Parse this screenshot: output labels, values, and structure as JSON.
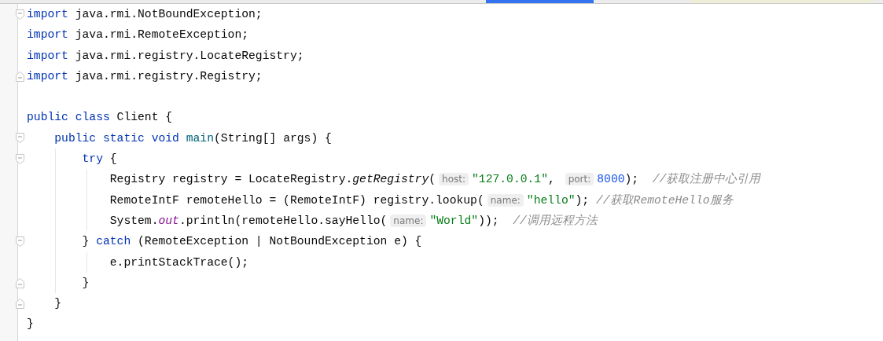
{
  "editor": {
    "lines": [
      {
        "fold": {
          "kind": "start"
        },
        "tokens": [
          {
            "kind": "keyword",
            "text": "import"
          },
          {
            "kind": "plain",
            "text": " java.rmi.NotBoundException;"
          }
        ]
      },
      {
        "tokens": [
          {
            "kind": "keyword",
            "text": "import"
          },
          {
            "kind": "plain",
            "text": " java.rmi.RemoteException;"
          }
        ]
      },
      {
        "tokens": [
          {
            "kind": "keyword",
            "text": "import"
          },
          {
            "kind": "plain",
            "text": " java.rmi.registry.LocateRegistry;"
          }
        ]
      },
      {
        "fold": {
          "kind": "end"
        },
        "tokens": [
          {
            "kind": "keyword",
            "text": "import"
          },
          {
            "kind": "plain",
            "text": " java.rmi.registry.Registry;"
          }
        ]
      },
      {
        "blank_line_before": true,
        "tokens": [
          {
            "kind": "keyword",
            "text": "public class"
          },
          {
            "kind": "plain",
            "text": " Client {"
          }
        ]
      },
      {
        "fold": {
          "kind": "start"
        },
        "tokens": [
          {
            "kind": "keyword",
            "text": "    public static void "
          },
          {
            "kind": "declaration",
            "text": "main"
          },
          {
            "kind": "plain",
            "text": "(String[] args) {"
          }
        ]
      },
      {
        "fold": {
          "kind": "start"
        },
        "tokens": [
          {
            "kind": "keyword",
            "text": "        try"
          },
          {
            "kind": "plain",
            "text": " {"
          }
        ]
      },
      {
        "tokens": [
          {
            "kind": "plain",
            "text": "            Registry registry = LocateRegistry."
          },
          {
            "kind": "static-call",
            "text": "getRegistry"
          },
          {
            "kind": "plain",
            "text": "("
          },
          {
            "kind": "hint",
            "text": "host:"
          },
          {
            "kind": "string",
            "text": "\"127.0.0.1\""
          },
          {
            "kind": "plain",
            "text": ", "
          },
          {
            "kind": "hint",
            "text": "port:"
          },
          {
            "kind": "number",
            "text": "8000"
          },
          {
            "kind": "plain",
            "text": ");  "
          },
          {
            "kind": "comment",
            "text": "//获取注册中心引用"
          }
        ]
      },
      {
        "tokens": [
          {
            "kind": "plain",
            "text": "            RemoteIntF remoteHello = (RemoteIntF) registry.lookup("
          },
          {
            "kind": "hint",
            "text": "name:"
          },
          {
            "kind": "string",
            "text": "\"hello\""
          },
          {
            "kind": "plain",
            "text": "); "
          },
          {
            "kind": "comment",
            "text": "//获取RemoteHello服务"
          }
        ]
      },
      {
        "tokens": [
          {
            "kind": "plain",
            "text": "            System."
          },
          {
            "kind": "static-field",
            "text": "out"
          },
          {
            "kind": "plain",
            "text": ".println(remoteHello.sayHello("
          },
          {
            "kind": "hint",
            "text": "name:"
          },
          {
            "kind": "string",
            "text": "\"World\""
          },
          {
            "kind": "plain",
            "text": "));  "
          },
          {
            "kind": "comment",
            "text": "//调用远程方法"
          }
        ]
      },
      {
        "fold": {
          "kind": "start"
        },
        "tokens": [
          {
            "kind": "plain",
            "text": "        } "
          },
          {
            "kind": "keyword",
            "text": "catch"
          },
          {
            "kind": "plain",
            "text": " (RemoteException | NotBoundException e) {"
          }
        ]
      },
      {
        "tokens": [
          {
            "kind": "plain",
            "text": "            e.printStackTrace();"
          }
        ]
      },
      {
        "fold": {
          "kind": "end"
        },
        "tokens": [
          {
            "kind": "plain",
            "text": "        }"
          }
        ]
      },
      {
        "fold": {
          "kind": "end"
        },
        "tokens": [
          {
            "kind": "plain",
            "text": "    }"
          }
        ]
      },
      {
        "tokens": [
          {
            "kind": "plain",
            "text": "}"
          }
        ]
      }
    ]
  }
}
